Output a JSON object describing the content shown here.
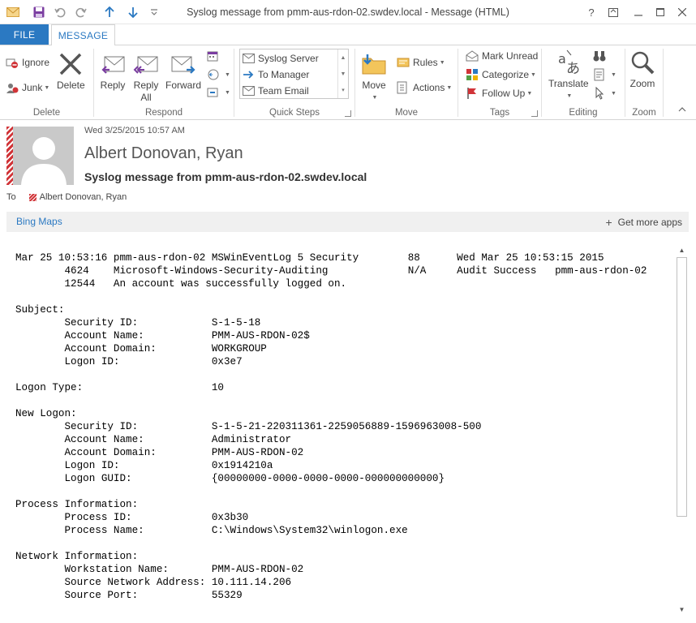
{
  "window": {
    "title": "Syslog message from pmm-aus-rdon-02.swdev.local - Message (HTML)",
    "controls": [
      "?",
      "restore",
      "minimize",
      "maximize",
      "close"
    ]
  },
  "tabs": {
    "file": "FILE",
    "message": "MESSAGE"
  },
  "ribbon": {
    "delete": {
      "label": "Delete",
      "ignore": "Ignore",
      "junk": "Junk",
      "delete": "Delete"
    },
    "respond": {
      "label": "Respond",
      "reply": "Reply",
      "reply_all_1": "Reply",
      "reply_all_2": "All",
      "forward": "Forward"
    },
    "quick_steps": {
      "label": "Quick Steps",
      "items": [
        "Syslog Server",
        "To Manager",
        "Team Email"
      ]
    },
    "move": {
      "label": "Move",
      "move": "Move",
      "rules": "Rules",
      "actions": "Actions"
    },
    "tags": {
      "label": "Tags",
      "mark_unread": "Mark Unread",
      "categorize": "Categorize",
      "follow_up": "Follow Up"
    },
    "editing": {
      "label": "Editing",
      "translate": "Translate"
    },
    "zoom": {
      "label": "Zoom",
      "zoom": "Zoom"
    }
  },
  "message": {
    "date": "Wed 3/25/2015 10:57 AM",
    "sender": "Albert Donovan, Ryan",
    "subject": "Syslog message from pmm-aus-rdon-02.swdev.local",
    "to_label": "To",
    "to_name": "Albert Donovan, Ryan"
  },
  "apps": {
    "bing_maps": "Bing Maps",
    "get_more_apps": "Get more apps"
  },
  "body_text": "Mar 25 10:53:16 pmm-aus-rdon-02 MSWinEventLog 5\tSecurity\t88\tWed Mar 25 10:53:15 2015\n\t4624\tMicrosoft-Windows-Security-Auditing\t\tN/A\tAudit Success\tpmm-aus-rdon-02\n\t12544\tAn account was successfully logged on.\n\nSubject:\n\tSecurity ID:\t\tS-1-5-18\n\tAccount Name:\t\tPMM-AUS-RDON-02$\n\tAccount Domain:\t\tWORKGROUP\n\tLogon ID:\t\t0x3e7\n\nLogon Type:\t\t\t10\n\nNew Logon:\n\tSecurity ID:\t\tS-1-5-21-220311361-2259056889-1596963008-500\n\tAccount Name:\t\tAdministrator\n\tAccount Domain:\t\tPMM-AUS-RDON-02\n\tLogon ID:\t\t0x1914210a\n\tLogon GUID:\t\t{00000000-0000-0000-0000-000000000000}\n\nProcess Information:\n\tProcess ID:\t\t0x3b30\n\tProcess Name:\t\tC:\\Windows\\System32\\winlogon.exe\n\nNetwork Information:\n\tWorkstation Name:\tPMM-AUS-RDON-02\n\tSource Network Address:\t10.111.14.206\n\tSource Port:\t\t55329",
  "colors": {
    "accent": "#2b79c2",
    "flag": "#d13438"
  }
}
